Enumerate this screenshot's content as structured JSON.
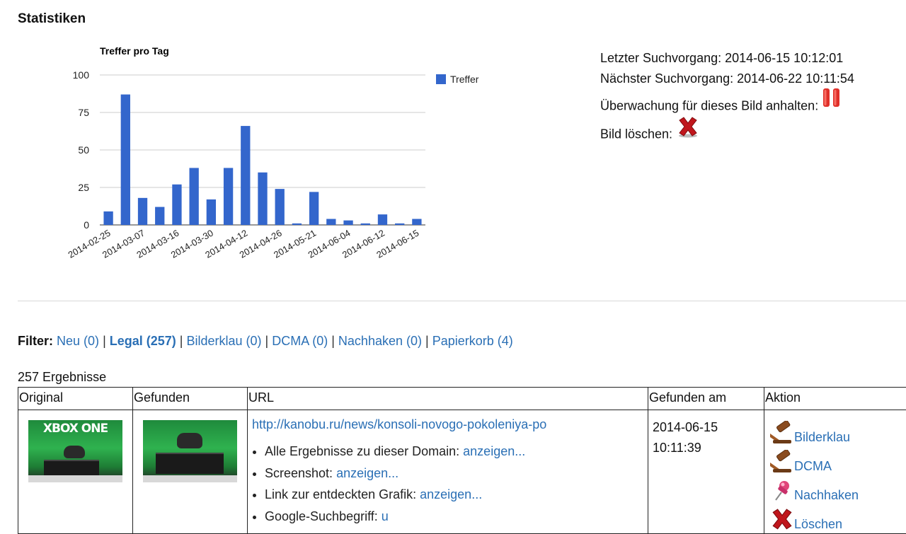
{
  "page": {
    "title": "Statistiken"
  },
  "chart_data": {
    "type": "bar",
    "title": "Treffer pro Tag",
    "legend": "Treffer",
    "legend_position": "right",
    "ylim": [
      0,
      100
    ],
    "yticks": [
      0,
      25,
      50,
      75,
      100
    ],
    "grid": true,
    "color": "#3366cc",
    "x_tick_labels": [
      "2014-02-25",
      "2014-03-07",
      "2014-03-16",
      "2014-03-30",
      "2014-04-12",
      "2014-04-26",
      "2014-05-21",
      "2014-06-04",
      "2014-06-12",
      "2014-06-15"
    ],
    "values": [
      9,
      87,
      18,
      12,
      27,
      38,
      17,
      38,
      66,
      35,
      24,
      1,
      22,
      4,
      3,
      1,
      7,
      1,
      4
    ]
  },
  "stats": {
    "last_search_label": "Letzter Suchvorgang: 2014-06-15 10:12:01",
    "next_search_label": "Nächster Suchvorgang: 2014-06-22 10:11:54",
    "pause_label": "Überwachung für dieses Bild anhalten:",
    "delete_label": "Bild löschen:",
    "pause_icon": "pause-icon",
    "delete_icon": "red-x-icon"
  },
  "filter": {
    "label": "Filter:",
    "items": [
      {
        "label": "Neu (0)"
      },
      {
        "label": "Legal (257)"
      },
      {
        "label": "Bilderklau (0)"
      },
      {
        "label": "DCMA (0)"
      },
      {
        "label": "Nachhaken (0)"
      },
      {
        "label": "Papierkorb (4)"
      }
    ]
  },
  "results": {
    "count_label": "257 Ergebnisse",
    "columns": [
      "Original",
      "Gefunden",
      "URL",
      "Gefunden am",
      "Aktion"
    ],
    "rows": [
      {
        "original_thumb_text": "XBOX ONE",
        "url": "http://kanobu.ru/news/konsoli-novogo-pokoleniya-po",
        "details": [
          {
            "label": "Alle Ergebnisse zu dieser Domain:",
            "link": "anzeigen..."
          },
          {
            "label": "Screenshot:",
            "link": "anzeigen..."
          },
          {
            "label": "Link zur entdeckten Grafik:",
            "link": "anzeigen..."
          },
          {
            "label": "Google-Suchbegriff:",
            "link": "u"
          }
        ],
        "found_date": "2014-06-15",
        "found_time": "10:11:39",
        "actions": [
          {
            "label": "Bilderklau",
            "icon": "gavel-icon"
          },
          {
            "label": "DCMA",
            "icon": "gavel-icon"
          },
          {
            "label": "Nachhaken",
            "icon": "pushpin-icon"
          },
          {
            "label": "Löschen",
            "icon": "red-x-icon"
          }
        ]
      }
    ]
  }
}
